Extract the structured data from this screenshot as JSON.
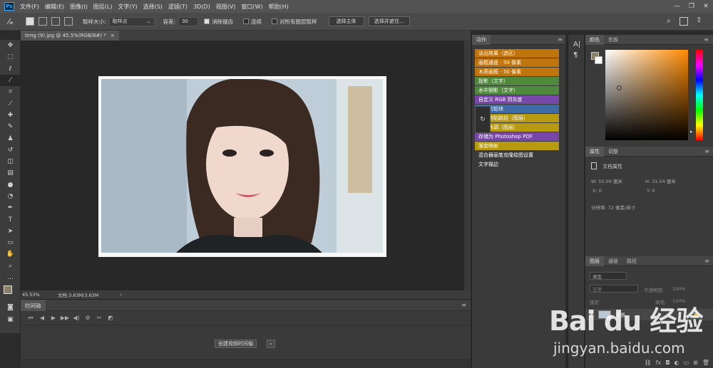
{
  "menubar": {
    "logo": "Ps",
    "items": [
      "文件(F)",
      "编辑(E)",
      "图像(I)",
      "图层(L)",
      "文字(Y)",
      "选择(S)",
      "滤镜(T)",
      "3D(D)",
      "视图(V)",
      "窗口(W)",
      "帮助(H)"
    ]
  },
  "options": {
    "sample_size_label": "取样大小:",
    "sample_size_value": "取样点",
    "tolerance_label": "容差:",
    "tolerance_value": "30",
    "antialias_label": "消除锯齿",
    "contiguous_label": "连续",
    "all_layers_label": "对所有图层取样",
    "select_subject_label": "选择主体",
    "select_mask_label": "选择并遮住..."
  },
  "document": {
    "tab_title": "timg (9).jpg @ 45.5%(RGB/8#) *",
    "zoom": "45.53%",
    "doc_size": "文档:3.63M/3.63M"
  },
  "timeline": {
    "tab": "时间轴",
    "create_button": "创建视频时间轴"
  },
  "actions": {
    "tab": "动作",
    "items": [
      {
        "label": "淡出效果（选区）",
        "color": "#c0740c"
      },
      {
        "label": "画框通道 - 50 像素",
        "color": "#c0740c"
      },
      {
        "label": "木质画框 - 50 像素",
        "color": "#c0740c"
      },
      {
        "label": "投影（文字）",
        "color": "#4f8a3c"
      },
      {
        "label": "水中倒影（文字）",
        "color": "#4f8a3c"
      },
      {
        "label": "自定义 RGB 到灰度",
        "color": "#7748a8"
      },
      {
        "label": "熔化的铅块",
        "color": "#3e6aa6"
      },
      {
        "label": "制作剪贴路径（图层）",
        "color": "#b89a10"
      },
      {
        "label": "棕褐色调（图层）",
        "color": "#b89a10"
      },
      {
        "label": "存储为 Photoshop PDF",
        "color": "#7748a8"
      },
      {
        "label": "渐变映射",
        "color": "#b89a10"
      },
      {
        "label": "混合器画笔克隆绘图设置",
        "color": "#3a3a3a"
      },
      {
        "label": "文字描边",
        "color": "#3a3a3a"
      }
    ]
  },
  "color_panel": {
    "tabs": [
      "颜色",
      "色板"
    ],
    "fg_color": "#8a8068"
  },
  "properties": {
    "tabs": [
      "属性",
      "调整"
    ],
    "title": "文档属性",
    "w": "W: 50.09 厘米",
    "h": "H: 31.54 厘米",
    "x": "X: 0",
    "y": "Y: 0",
    "resolution": "分辨率: 72 像素/英寸"
  },
  "layers": {
    "tabs": [
      "图层",
      "通道",
      "路径"
    ],
    "filter_label": "类型",
    "blend_mode": "正常",
    "opacity_label": "不透明度:",
    "opacity_value": "100%",
    "lock_label": "锁定:",
    "fill_label": "填充:",
    "fill_value": "100%",
    "layer_name": "背景"
  },
  "watermark": {
    "brand": "Bai du 经验",
    "url": "jingyan.baidu.com"
  }
}
